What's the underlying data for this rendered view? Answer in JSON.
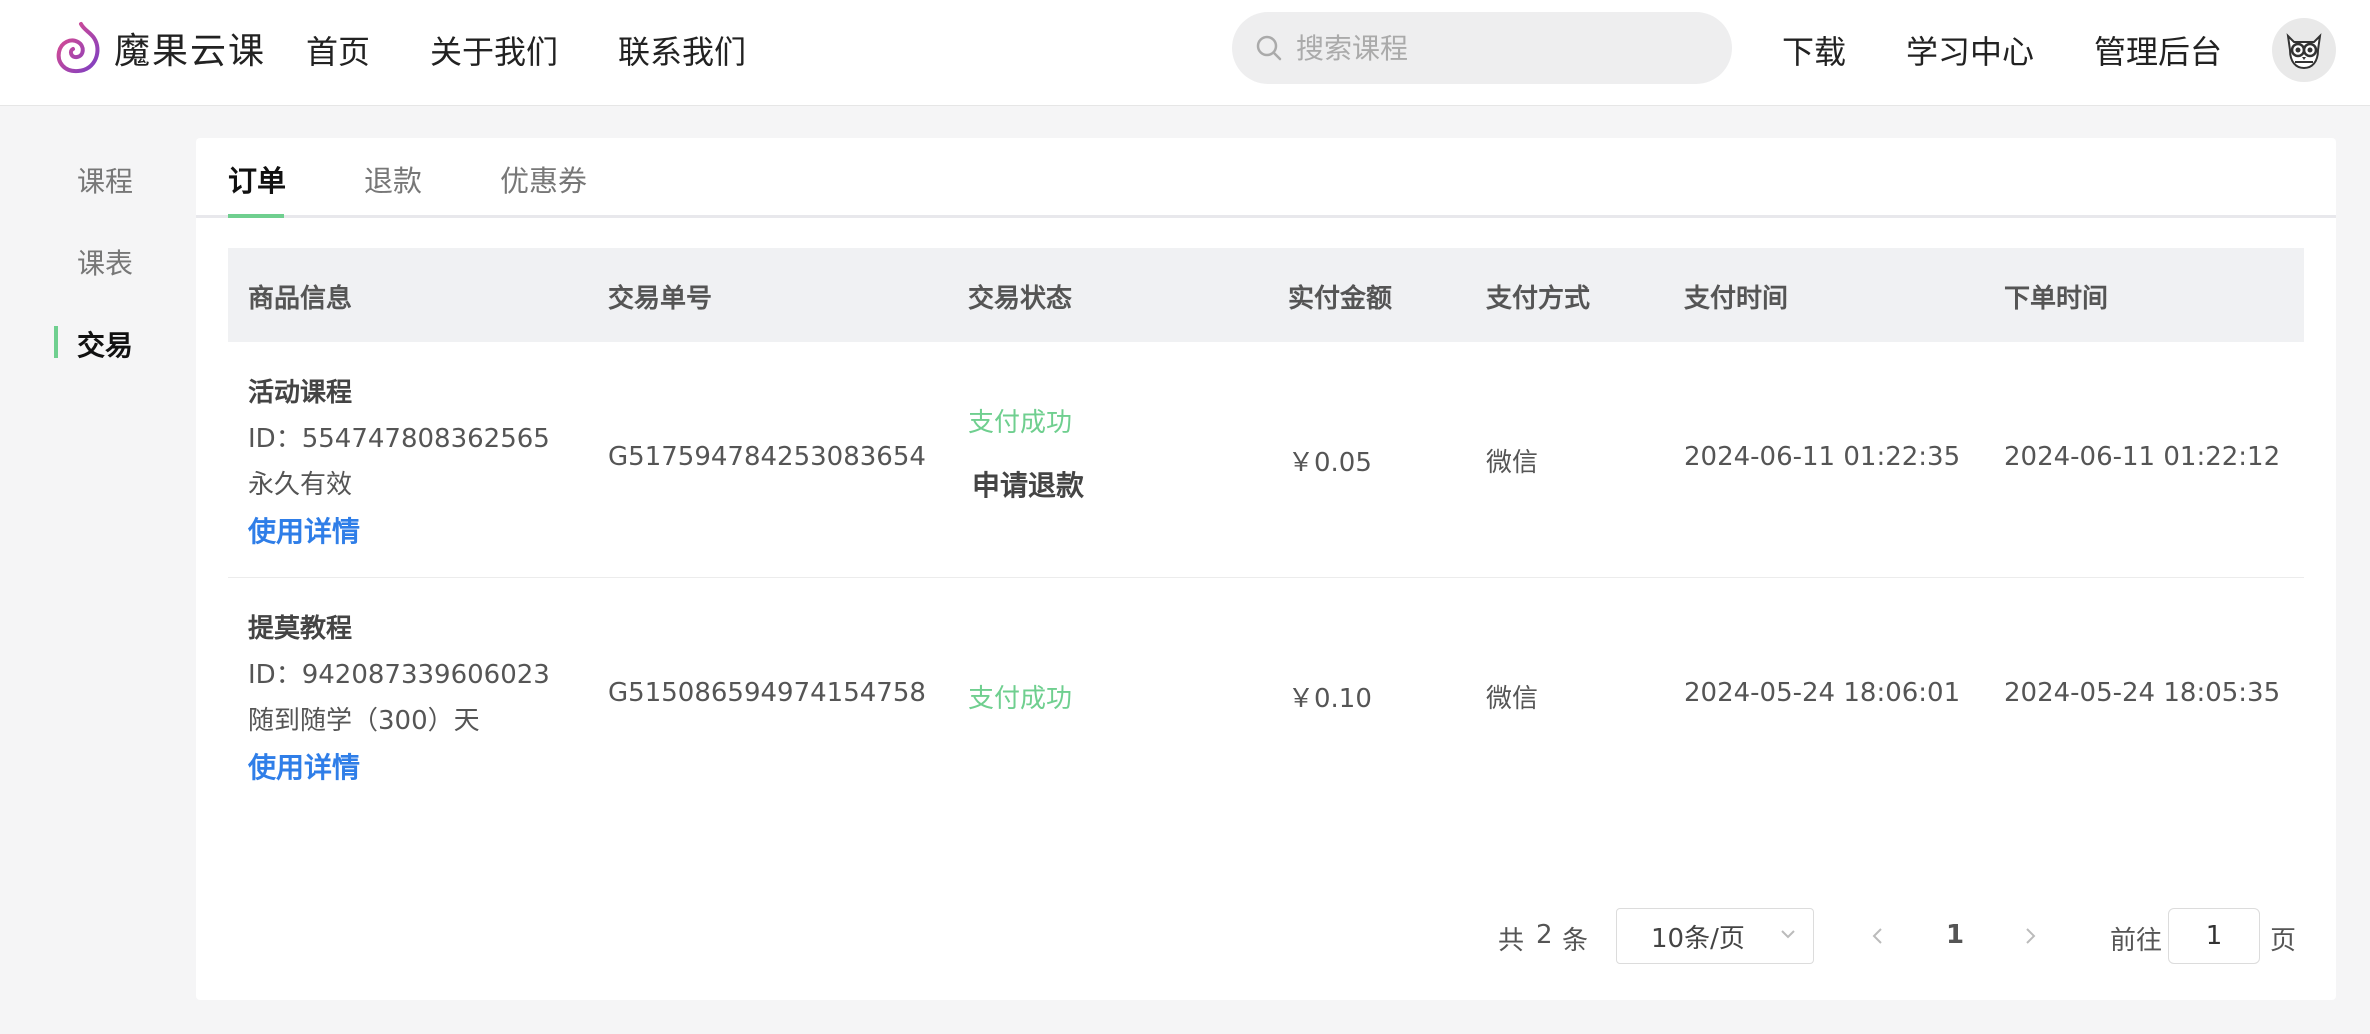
{
  "header": {
    "logo_text": "魔果云课",
    "nav": [
      "首页",
      "关于我们",
      "联系我们"
    ],
    "search_placeholder": "搜索课程",
    "right_nav": [
      "下载",
      "学习中心",
      "管理后台"
    ]
  },
  "sidebar": {
    "items": [
      {
        "label": "课程"
      },
      {
        "label": "课表"
      },
      {
        "label": "交易"
      }
    ]
  },
  "tabs": [
    "订单",
    "退款",
    "优惠券"
  ],
  "table": {
    "columns": [
      "商品信息",
      "交易单号",
      "交易状态",
      "实付金额",
      "支付方式",
      "支付时间",
      "下单时间"
    ],
    "rows": [
      {
        "name": "活动课程",
        "id": "ID：554747808362565",
        "validity": "永久有效",
        "detail_link": "使用详情",
        "order_no": "G517594784253083654",
        "status": "支付成功",
        "refund": "申请退款",
        "amount": "￥0.05",
        "pay_method": "微信",
        "pay_time": "2024-06-11 01:22:35",
        "order_time": "2024-06-11 01:22:12"
      },
      {
        "name": "提莫教程",
        "id": "ID：942087339606023",
        "validity": "随到随学（300）天",
        "detail_link": "使用详情",
        "order_no": "G515086594974154758",
        "status": "支付成功",
        "amount": "￥0.10",
        "pay_method": "微信",
        "pay_time": "2024-05-24 18:06:01",
        "order_time": "2024-05-24 18:05:35"
      }
    ]
  },
  "pagination": {
    "total_prefix": "共",
    "total": "2",
    "total_suffix": "条",
    "page_size": "10条/页",
    "current_page": "1",
    "goto_prefix": "前往",
    "goto_value": "1",
    "goto_suffix": "页"
  },
  "colors": {
    "accent_green": "#6fcf8f",
    "link_blue": "#2f7ee8",
    "logo_purple": "#b34bc7"
  }
}
